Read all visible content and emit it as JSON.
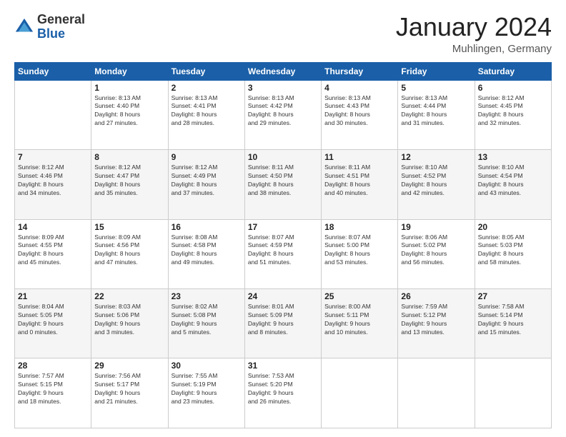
{
  "header": {
    "logo_general": "General",
    "logo_blue": "Blue",
    "month_title": "January 2024",
    "location": "Muhlingen, Germany"
  },
  "weekdays": [
    "Sunday",
    "Monday",
    "Tuesday",
    "Wednesday",
    "Thursday",
    "Friday",
    "Saturday"
  ],
  "weeks": [
    [
      {
        "day": "",
        "info": ""
      },
      {
        "day": "1",
        "info": "Sunrise: 8:13 AM\nSunset: 4:40 PM\nDaylight: 8 hours\nand 27 minutes."
      },
      {
        "day": "2",
        "info": "Sunrise: 8:13 AM\nSunset: 4:41 PM\nDaylight: 8 hours\nand 28 minutes."
      },
      {
        "day": "3",
        "info": "Sunrise: 8:13 AM\nSunset: 4:42 PM\nDaylight: 8 hours\nand 29 minutes."
      },
      {
        "day": "4",
        "info": "Sunrise: 8:13 AM\nSunset: 4:43 PM\nDaylight: 8 hours\nand 30 minutes."
      },
      {
        "day": "5",
        "info": "Sunrise: 8:13 AM\nSunset: 4:44 PM\nDaylight: 8 hours\nand 31 minutes."
      },
      {
        "day": "6",
        "info": "Sunrise: 8:12 AM\nSunset: 4:45 PM\nDaylight: 8 hours\nand 32 minutes."
      }
    ],
    [
      {
        "day": "7",
        "info": "Sunrise: 8:12 AM\nSunset: 4:46 PM\nDaylight: 8 hours\nand 34 minutes."
      },
      {
        "day": "8",
        "info": "Sunrise: 8:12 AM\nSunset: 4:47 PM\nDaylight: 8 hours\nand 35 minutes."
      },
      {
        "day": "9",
        "info": "Sunrise: 8:12 AM\nSunset: 4:49 PM\nDaylight: 8 hours\nand 37 minutes."
      },
      {
        "day": "10",
        "info": "Sunrise: 8:11 AM\nSunset: 4:50 PM\nDaylight: 8 hours\nand 38 minutes."
      },
      {
        "day": "11",
        "info": "Sunrise: 8:11 AM\nSunset: 4:51 PM\nDaylight: 8 hours\nand 40 minutes."
      },
      {
        "day": "12",
        "info": "Sunrise: 8:10 AM\nSunset: 4:52 PM\nDaylight: 8 hours\nand 42 minutes."
      },
      {
        "day": "13",
        "info": "Sunrise: 8:10 AM\nSunset: 4:54 PM\nDaylight: 8 hours\nand 43 minutes."
      }
    ],
    [
      {
        "day": "14",
        "info": "Sunrise: 8:09 AM\nSunset: 4:55 PM\nDaylight: 8 hours\nand 45 minutes."
      },
      {
        "day": "15",
        "info": "Sunrise: 8:09 AM\nSunset: 4:56 PM\nDaylight: 8 hours\nand 47 minutes."
      },
      {
        "day": "16",
        "info": "Sunrise: 8:08 AM\nSunset: 4:58 PM\nDaylight: 8 hours\nand 49 minutes."
      },
      {
        "day": "17",
        "info": "Sunrise: 8:07 AM\nSunset: 4:59 PM\nDaylight: 8 hours\nand 51 minutes."
      },
      {
        "day": "18",
        "info": "Sunrise: 8:07 AM\nSunset: 5:00 PM\nDaylight: 8 hours\nand 53 minutes."
      },
      {
        "day": "19",
        "info": "Sunrise: 8:06 AM\nSunset: 5:02 PM\nDaylight: 8 hours\nand 56 minutes."
      },
      {
        "day": "20",
        "info": "Sunrise: 8:05 AM\nSunset: 5:03 PM\nDaylight: 8 hours\nand 58 minutes."
      }
    ],
    [
      {
        "day": "21",
        "info": "Sunrise: 8:04 AM\nSunset: 5:05 PM\nDaylight: 9 hours\nand 0 minutes."
      },
      {
        "day": "22",
        "info": "Sunrise: 8:03 AM\nSunset: 5:06 PM\nDaylight: 9 hours\nand 3 minutes."
      },
      {
        "day": "23",
        "info": "Sunrise: 8:02 AM\nSunset: 5:08 PM\nDaylight: 9 hours\nand 5 minutes."
      },
      {
        "day": "24",
        "info": "Sunrise: 8:01 AM\nSunset: 5:09 PM\nDaylight: 9 hours\nand 8 minutes."
      },
      {
        "day": "25",
        "info": "Sunrise: 8:00 AM\nSunset: 5:11 PM\nDaylight: 9 hours\nand 10 minutes."
      },
      {
        "day": "26",
        "info": "Sunrise: 7:59 AM\nSunset: 5:12 PM\nDaylight: 9 hours\nand 13 minutes."
      },
      {
        "day": "27",
        "info": "Sunrise: 7:58 AM\nSunset: 5:14 PM\nDaylight: 9 hours\nand 15 minutes."
      }
    ],
    [
      {
        "day": "28",
        "info": "Sunrise: 7:57 AM\nSunset: 5:15 PM\nDaylight: 9 hours\nand 18 minutes."
      },
      {
        "day": "29",
        "info": "Sunrise: 7:56 AM\nSunset: 5:17 PM\nDaylight: 9 hours\nand 21 minutes."
      },
      {
        "day": "30",
        "info": "Sunrise: 7:55 AM\nSunset: 5:19 PM\nDaylight: 9 hours\nand 23 minutes."
      },
      {
        "day": "31",
        "info": "Sunrise: 7:53 AM\nSunset: 5:20 PM\nDaylight: 9 hours\nand 26 minutes."
      },
      {
        "day": "",
        "info": ""
      },
      {
        "day": "",
        "info": ""
      },
      {
        "day": "",
        "info": ""
      }
    ]
  ]
}
